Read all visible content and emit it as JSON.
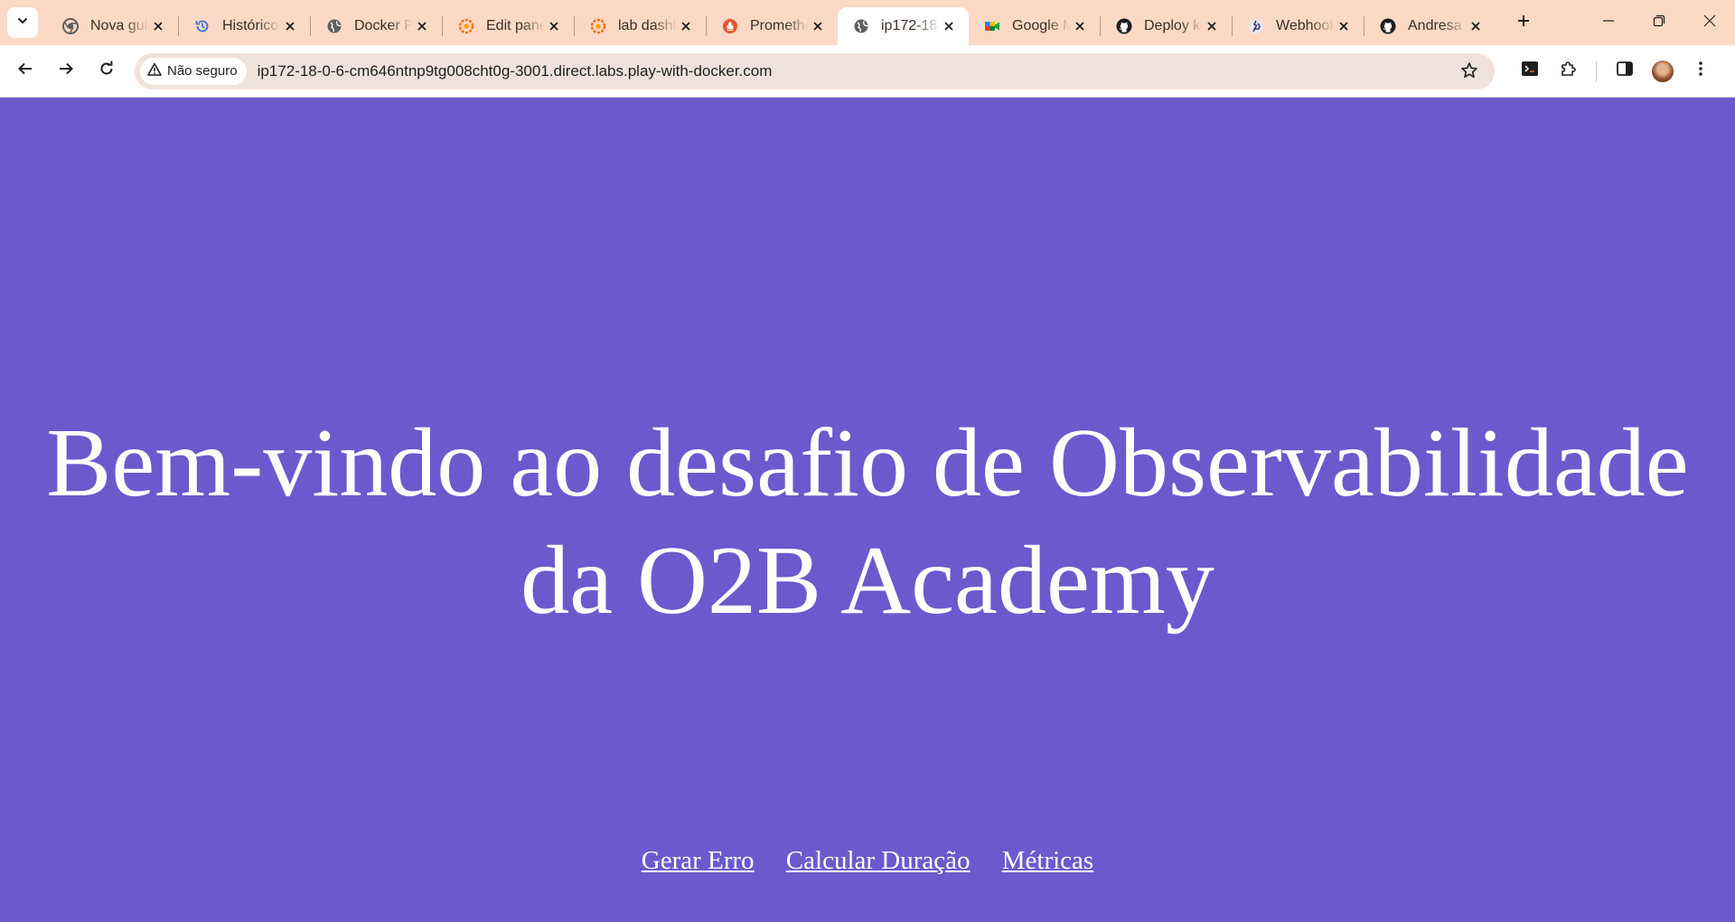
{
  "browser": {
    "tabs": [
      {
        "title": "Nova guia",
        "icon": "chrome-icon",
        "active": false
      },
      {
        "title": "Histórico",
        "icon": "history-icon",
        "active": false
      },
      {
        "title": "Docker Playground",
        "icon": "globe-icon",
        "active": false
      },
      {
        "title": "Edit panel",
        "icon": "grafana-icon",
        "active": false
      },
      {
        "title": "lab dashboard",
        "icon": "grafana-icon",
        "active": false
      },
      {
        "title": "Prometheus",
        "icon": "prometheus-icon",
        "active": false
      },
      {
        "title": "ip172-18",
        "icon": "globe-icon",
        "active": true
      },
      {
        "title": "Google Meet",
        "icon": "meet-icon",
        "active": false
      },
      {
        "title": "Deploy keys",
        "icon": "github-icon",
        "active": false
      },
      {
        "title": "Webhooks",
        "icon": "webhook-icon",
        "active": false
      },
      {
        "title": "Andresa",
        "icon": "github-icon",
        "active": false
      }
    ],
    "address_bar": {
      "security_label": "Não seguro",
      "url": "ip172-18-0-6-cm646ntnp9tg008cht0g-3001.direct.labs.play-with-docker.com"
    },
    "colors": {
      "tabstrip_bg": "#fbd9c5",
      "omnibox_bg": "#f0e2da",
      "page_bg": "#6a5acd"
    }
  },
  "page": {
    "headline_line1": "Bem-vindo ao desafio de Observabilidade",
    "headline_line2": "da O2B Academy",
    "links": [
      {
        "label": "Gerar Erro"
      },
      {
        "label": "Calcular Duração"
      },
      {
        "label": "Métricas"
      }
    ]
  }
}
